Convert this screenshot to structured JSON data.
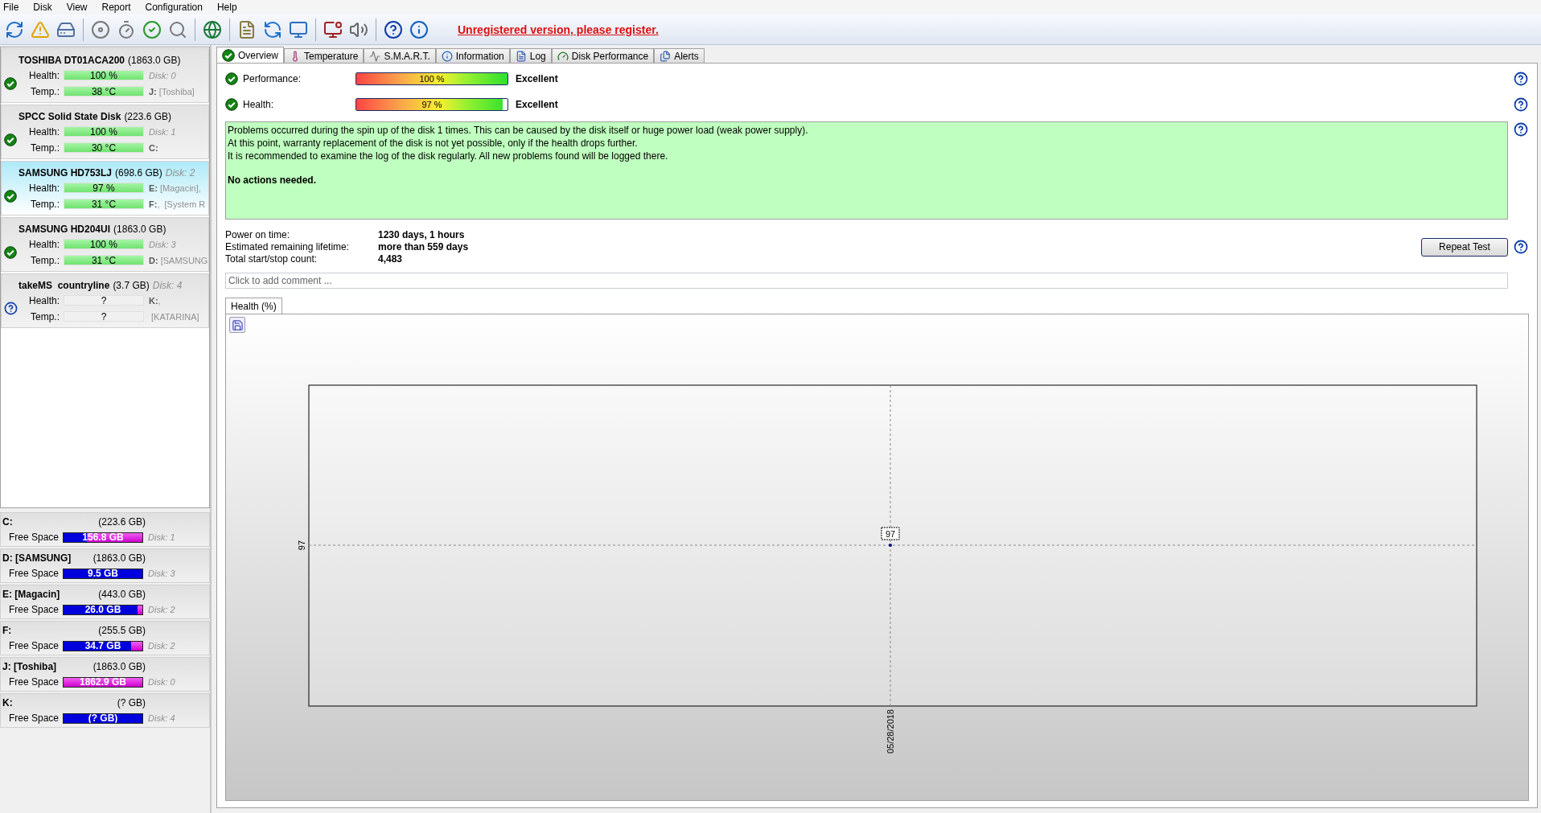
{
  "menu": [
    "File",
    "Disk",
    "View",
    "Report",
    "Configuration",
    "Help"
  ],
  "toolbar": {
    "notice": "Unregistered version, please register."
  },
  "disks": [
    {
      "name": "TOSHIBA DT01ACA200",
      "size": "(1863.0 GB)",
      "ok": true,
      "selected": false,
      "rows": [
        {
          "label": "Health:",
          "value": "100 %"
        },
        {
          "label": "Temp.:",
          "value": "38 °C"
        }
      ],
      "side": [
        {
          "kind": "disk",
          "text": "Disk: 0"
        },
        {
          "kind": "volume",
          "text": "**J:** [Toshiba]"
        }
      ]
    },
    {
      "name": "SPCC Solid State Disk",
      "size": "(223.6 GB)",
      "ok": true,
      "selected": false,
      "rows": [
        {
          "label": "Health:",
          "value": "100 %"
        },
        {
          "label": "Temp.:",
          "value": "30 °C"
        }
      ],
      "side": [
        {
          "kind": "disk",
          "text": "Disk: 1"
        },
        {
          "kind": "volume",
          "text": "**C:**"
        }
      ]
    },
    {
      "name": "SAMSUNG HD753LJ",
      "size": "(698.6 GB)",
      "header_note": "Disk: 2",
      "ok": true,
      "selected": true,
      "rows": [
        {
          "label": "Health:",
          "value": "97 %"
        },
        {
          "label": "Temp.:",
          "value": "31 °C"
        }
      ],
      "side": [
        {
          "kind": "volume",
          "text": "**E:** [Magacin],"
        },
        {
          "kind": "volume",
          "text": "**F:**,  [System R"
        }
      ]
    },
    {
      "name": "SAMSUNG HD204UI",
      "size": "(1863.0 GB)",
      "ok": true,
      "selected": false,
      "rows": [
        {
          "label": "Health:",
          "value": "100 %"
        },
        {
          "label": "Temp.:",
          "value": "31 °C"
        }
      ],
      "side": [
        {
          "kind": "disk",
          "text": "Disk: 3"
        },
        {
          "kind": "volume",
          "text": "**D:** [SAMSUNG"
        }
      ]
    },
    {
      "name": "takeMS  countryline",
      "size": "(3.7 GB)",
      "header_note": "Disk: 4",
      "ok": false,
      "selected": false,
      "rows": [
        {
          "label": "Health:",
          "value": "?"
        },
        {
          "label": "Temp.:",
          "value": "?"
        }
      ],
      "side": [
        {
          "kind": "volume",
          "text": "**K:**,"
        },
        {
          "kind": "volume",
          "text": " [KATARINA]"
        }
      ]
    }
  ],
  "volumes": [
    {
      "name": "C:",
      "size": "(223.6 GB)",
      "label": "Free Space",
      "free": "156.8 GB",
      "level": 0.7,
      "disk": "Disk: 1"
    },
    {
      "name": "D: [SAMSUNG]",
      "size": "(1863.0 GB)",
      "label": "Free Space",
      "free": "9.5 GB",
      "level": 0.005,
      "disk": "Disk: 3"
    },
    {
      "name": "E: [Magacin]",
      "size": "(443.0 GB)",
      "label": "Free Space",
      "free": "26.0 GB",
      "level": 0.06,
      "disk": "Disk: 2"
    },
    {
      "name": "F:",
      "size": "(255.5 GB)",
      "label": "Free Space",
      "free": "34.7 GB",
      "level": 0.14,
      "disk": "Disk: 2"
    },
    {
      "name": "J: [Toshiba]",
      "size": "(1863.0 GB)",
      "label": "Free Space",
      "free": "1862.9 GB",
      "level": 1,
      "disk": "Disk: 0"
    },
    {
      "name": "K:",
      "size": "(? GB)",
      "label": "Free Space",
      "free": "(? GB)",
      "level": 0,
      "disk": "Disk: 4"
    }
  ],
  "tabs": [
    {
      "label": "Overview",
      "selected": true
    },
    {
      "label": "Temperature",
      "selected": false
    },
    {
      "label": "S.M.A.R.T.",
      "selected": false
    },
    {
      "label": "Information",
      "selected": false
    },
    {
      "label": "Log",
      "selected": false
    },
    {
      "label": "Disk Performance",
      "selected": false
    },
    {
      "label": "Alerts",
      "selected": false
    }
  ],
  "ratings": [
    {
      "label": "Performance:",
      "ok": true,
      "value": "100 %",
      "level": 1,
      "rating": "Excellent"
    },
    {
      "label": "Health:",
      "ok": true,
      "value": "97 %",
      "level": 0.97,
      "rating": "Excellent"
    }
  ],
  "message": {
    "lines": [
      "Problems occurred during the spin up of the disk 1 times. This can be caused by the disk itself or huge power load (weak power supply).",
      "At this point, warranty replacement of the disk is not yet possible, only if the health drops further.",
      "It is recommended to examine the log of the disk regularly. All new problems found will be logged there."
    ],
    "conclusion": "No actions needed."
  },
  "stats": [
    {
      "label": "Power on time:",
      "value": "1230 days, 1 hours"
    },
    {
      "label": "Estimated remaining lifetime:",
      "value": "more than 559 days"
    },
    {
      "label": "Total start/stop count:",
      "value": "4,483"
    }
  ],
  "repeat_button": "Repeat Test",
  "comment": {
    "placeholder": "Click to add comment ..."
  },
  "chart_tabs": [
    {
      "label": "Health (%)",
      "selected": true
    }
  ],
  "health_chart": {
    "y_label": "97",
    "x_label": "05/28/2018",
    "point_label": "97"
  }
}
